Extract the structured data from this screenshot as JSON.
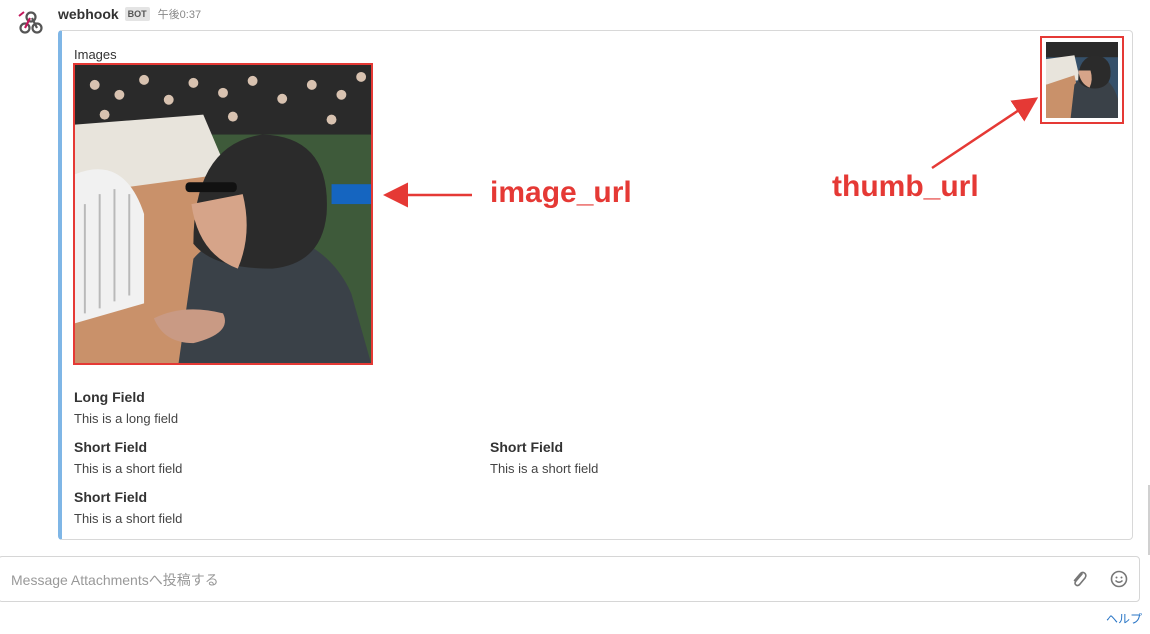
{
  "message": {
    "sender": "webhook",
    "badge": "BOT",
    "time": "午後0:37"
  },
  "attachment": {
    "title": "Images",
    "fields": [
      {
        "title": "Long Field",
        "value": "This is a long field"
      },
      {
        "title": "Short Field",
        "value": "This is a short field"
      },
      {
        "title": "Short Field",
        "value": "This is a short field"
      },
      {
        "title": "Short Field",
        "value": "This is a short field"
      }
    ]
  },
  "annotations": {
    "image": "image_url",
    "thumb": "thumb_url"
  },
  "composer": {
    "placeholder": "Message Attachmentsへ投稿する"
  },
  "footer": {
    "help": "ヘルプ"
  },
  "colors": {
    "accent_border": "#7fb6e6",
    "annotation_red": "#e53935"
  },
  "icons": [
    "webhook-icon",
    "paperclip-icon",
    "smiley-icon"
  ]
}
